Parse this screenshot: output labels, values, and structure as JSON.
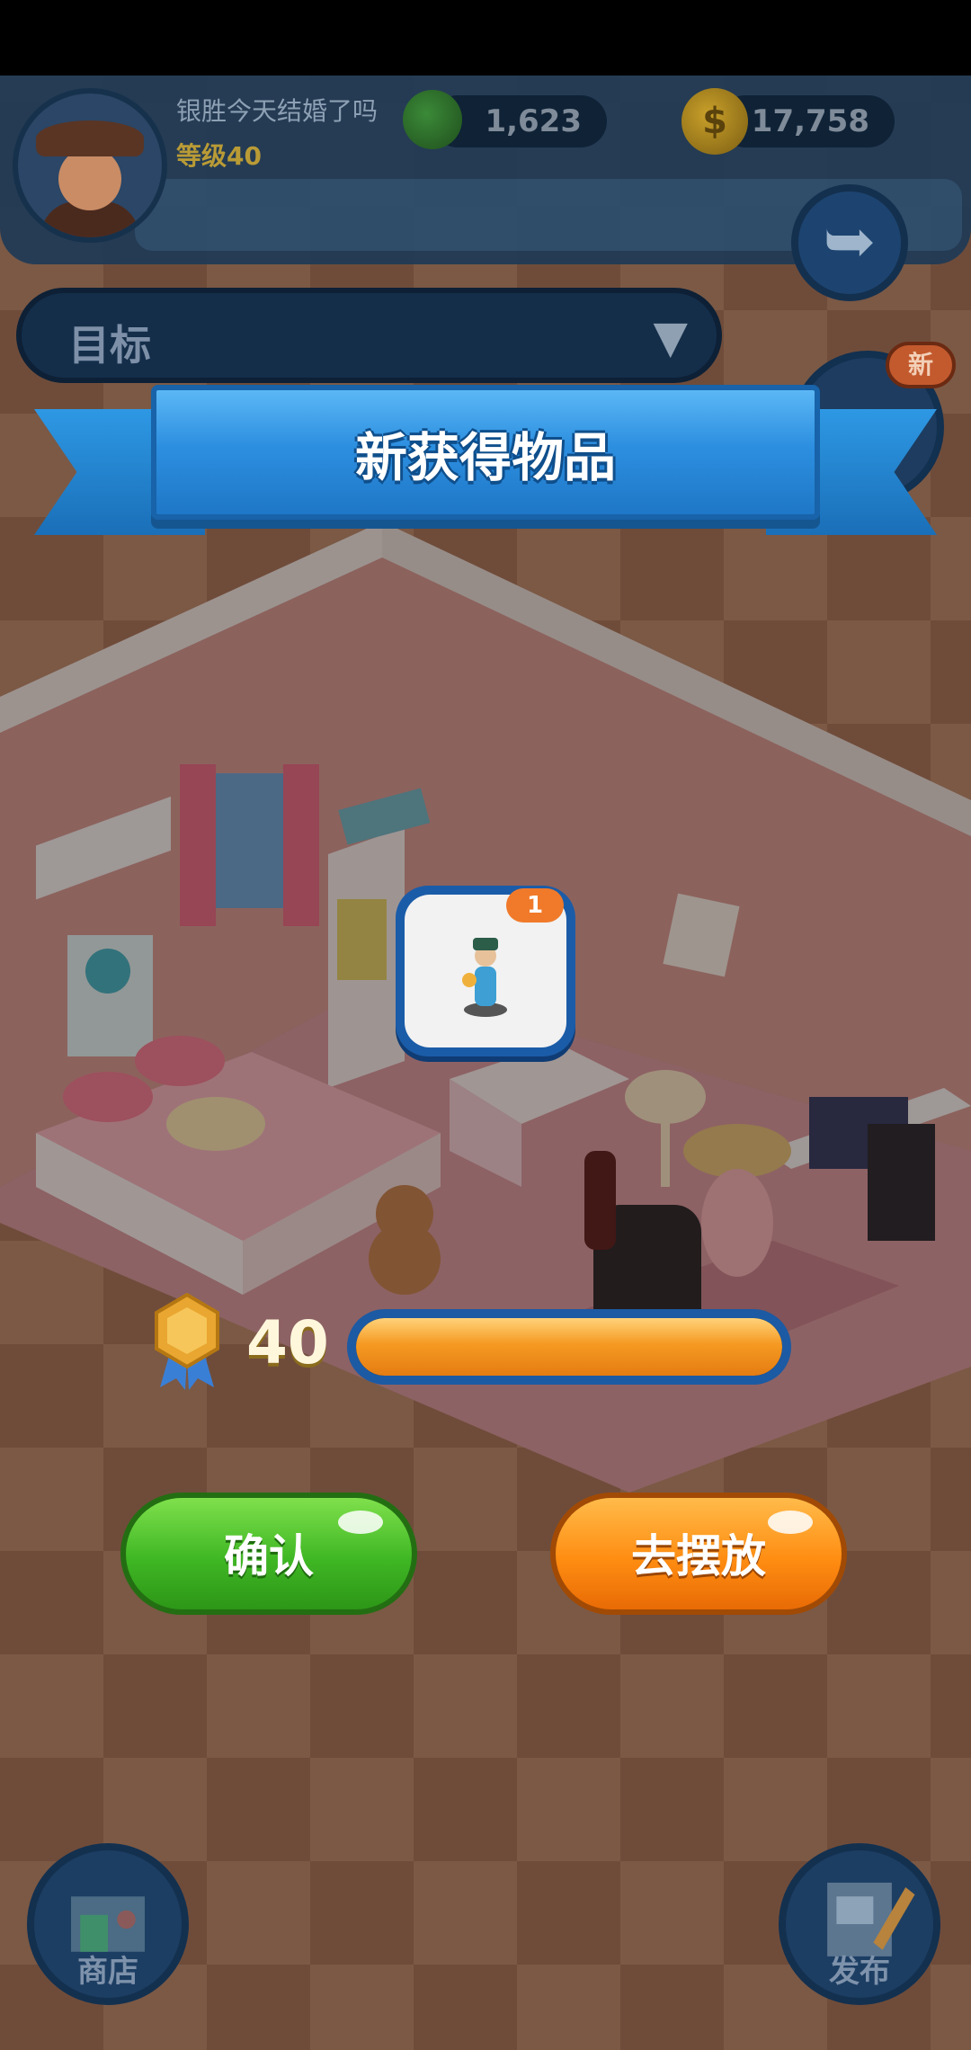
{
  "header": {
    "username": "银胜今天结婚了吗",
    "level_label": "等级40",
    "gems": "1,623",
    "coins": "17,758",
    "coin_symbol": "$"
  },
  "goal": {
    "label": "目标",
    "arrow": "▼"
  },
  "side_badge": "新",
  "dialog": {
    "title": "新获得物品",
    "item_count": "1",
    "level": "40",
    "progress_fraction": 1.0,
    "confirm_label": "确认",
    "place_label": "去摆放"
  },
  "bottom": {
    "shop_label": "商店",
    "publish_label": "发布"
  },
  "icons": {
    "share": "share-arrow-icon",
    "gem": "gem-icon",
    "coin": "coin-icon",
    "level_badge": "level-medal-icon"
  },
  "colors": {
    "banner": "#2d8fe0",
    "confirm": "#3fb724",
    "place": "#ff8d12",
    "progress": "#f59a22"
  }
}
